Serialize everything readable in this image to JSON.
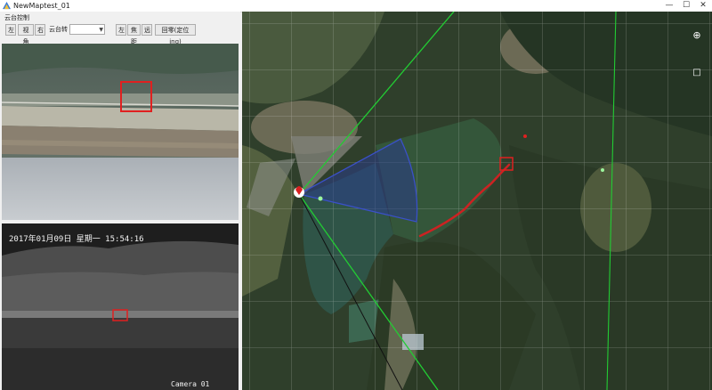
{
  "window": {
    "title": "NewMaptest_01",
    "controls": {
      "minimize": "—",
      "maximize": "☐",
      "close": "✕"
    }
  },
  "control_panel": {
    "title": "云台控制",
    "buttons": {
      "left_1": "左",
      "view_angle": "视角",
      "right_1": "右",
      "left_2": "左",
      "focus": "焦距",
      "far": "远",
      "home": "回零(定位ing)"
    },
    "ptz_label": "云台转",
    "ptz_select_value": ""
  },
  "thermal_camera": {
    "timestamp": "2017年01月09日 星期一 15:54:16",
    "camera_label": "Camera 01"
  },
  "map": {
    "toolbar": {
      "expand": "⊕",
      "fullscreen": "□"
    }
  }
}
